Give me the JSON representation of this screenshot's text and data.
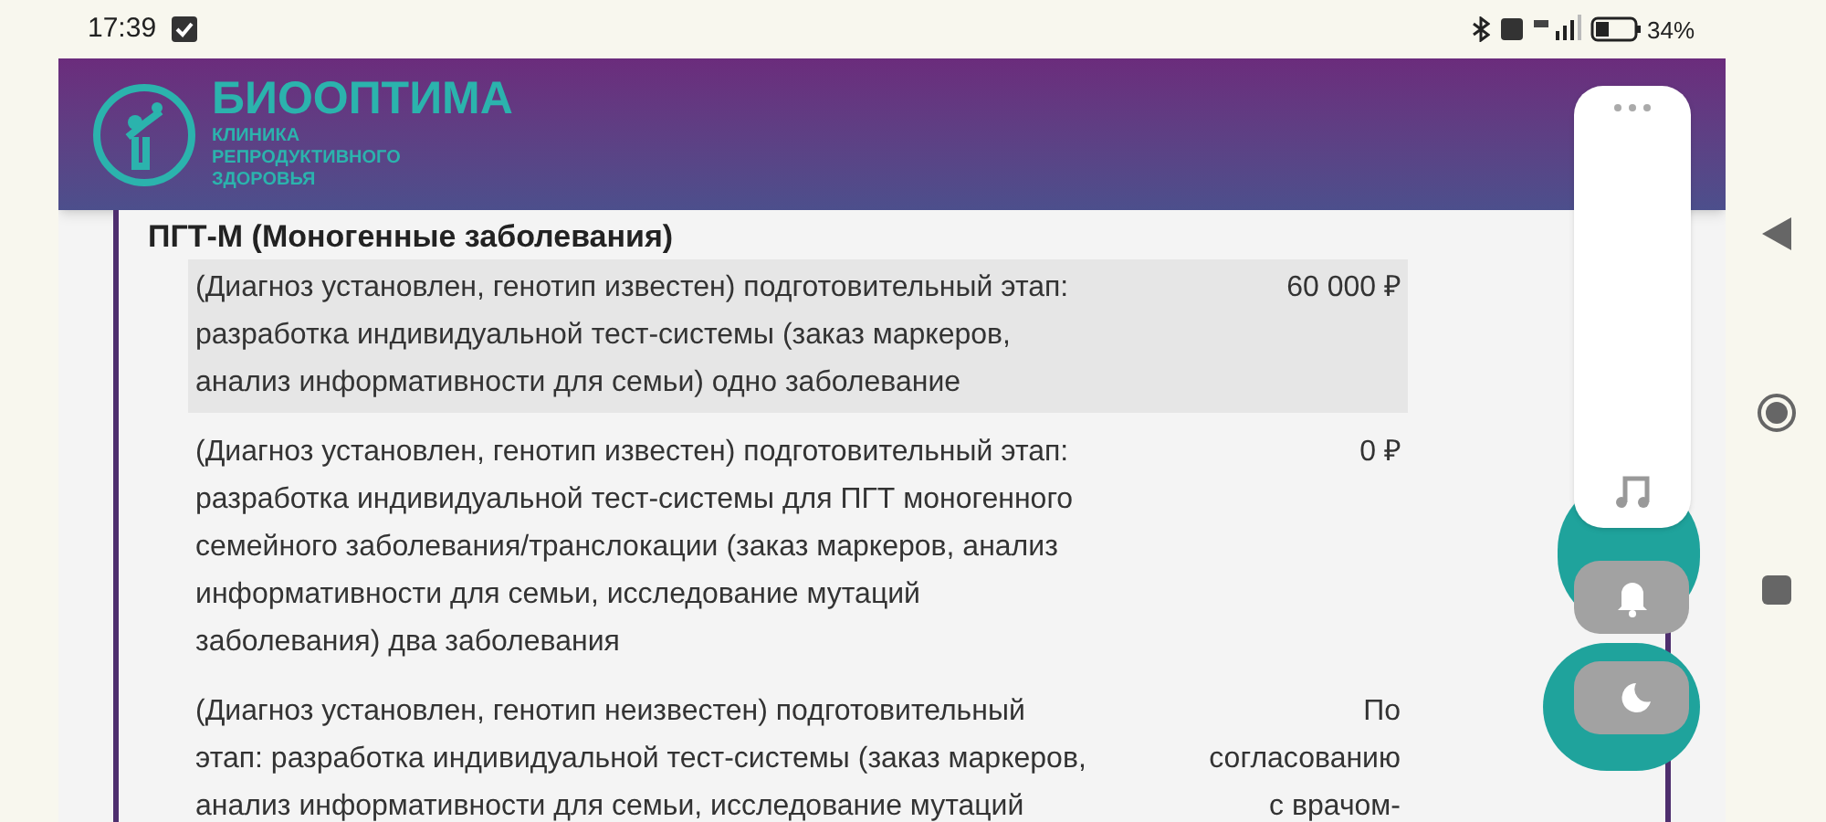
{
  "status_bar": {
    "time": "17:39",
    "battery": "34%"
  },
  "header": {
    "brand": "БИООПТИМА",
    "subtitle_lines": [
      "КЛИНИКА",
      "РЕПРОДУКТИВНОГО",
      "ЗДОРОВЬЯ"
    ]
  },
  "section": {
    "title": "ПГТ-М (Моногенные заболевания)",
    "rows": [
      {
        "highlighted": true,
        "description_lines": [
          "(Диагноз установлен, генотип известен) подготовительный этап:",
          "разработка индивидуальной тест-системы (заказ маркеров,",
          "анализ информативности для семьи) одно заболевание"
        ],
        "price_lines": [
          "60 000 ₽"
        ]
      },
      {
        "highlighted": false,
        "description_lines": [
          "(Диагноз установлен, генотип известен) подготовительный этап:",
          "разработка индивидуальной тест-системы для ПГТ моногенного",
          "семейного заболевания/транслокации (заказ маркеров, анализ",
          "информативности для семьи, исследование мутаций",
          "заболевания) два заболевания"
        ],
        "price_lines": [
          "0 ₽"
        ]
      },
      {
        "highlighted": false,
        "description_lines": [
          "(Диагноз установлен, генотип неизвестен) подготовительный",
          "этап: разработка индивидуальной тест-системы (заказ маркеров,",
          "анализ информативности для семьи, исследование мутаций"
        ],
        "price_lines": [
          "По",
          "согласованию",
          "с врачом-"
        ]
      }
    ]
  }
}
